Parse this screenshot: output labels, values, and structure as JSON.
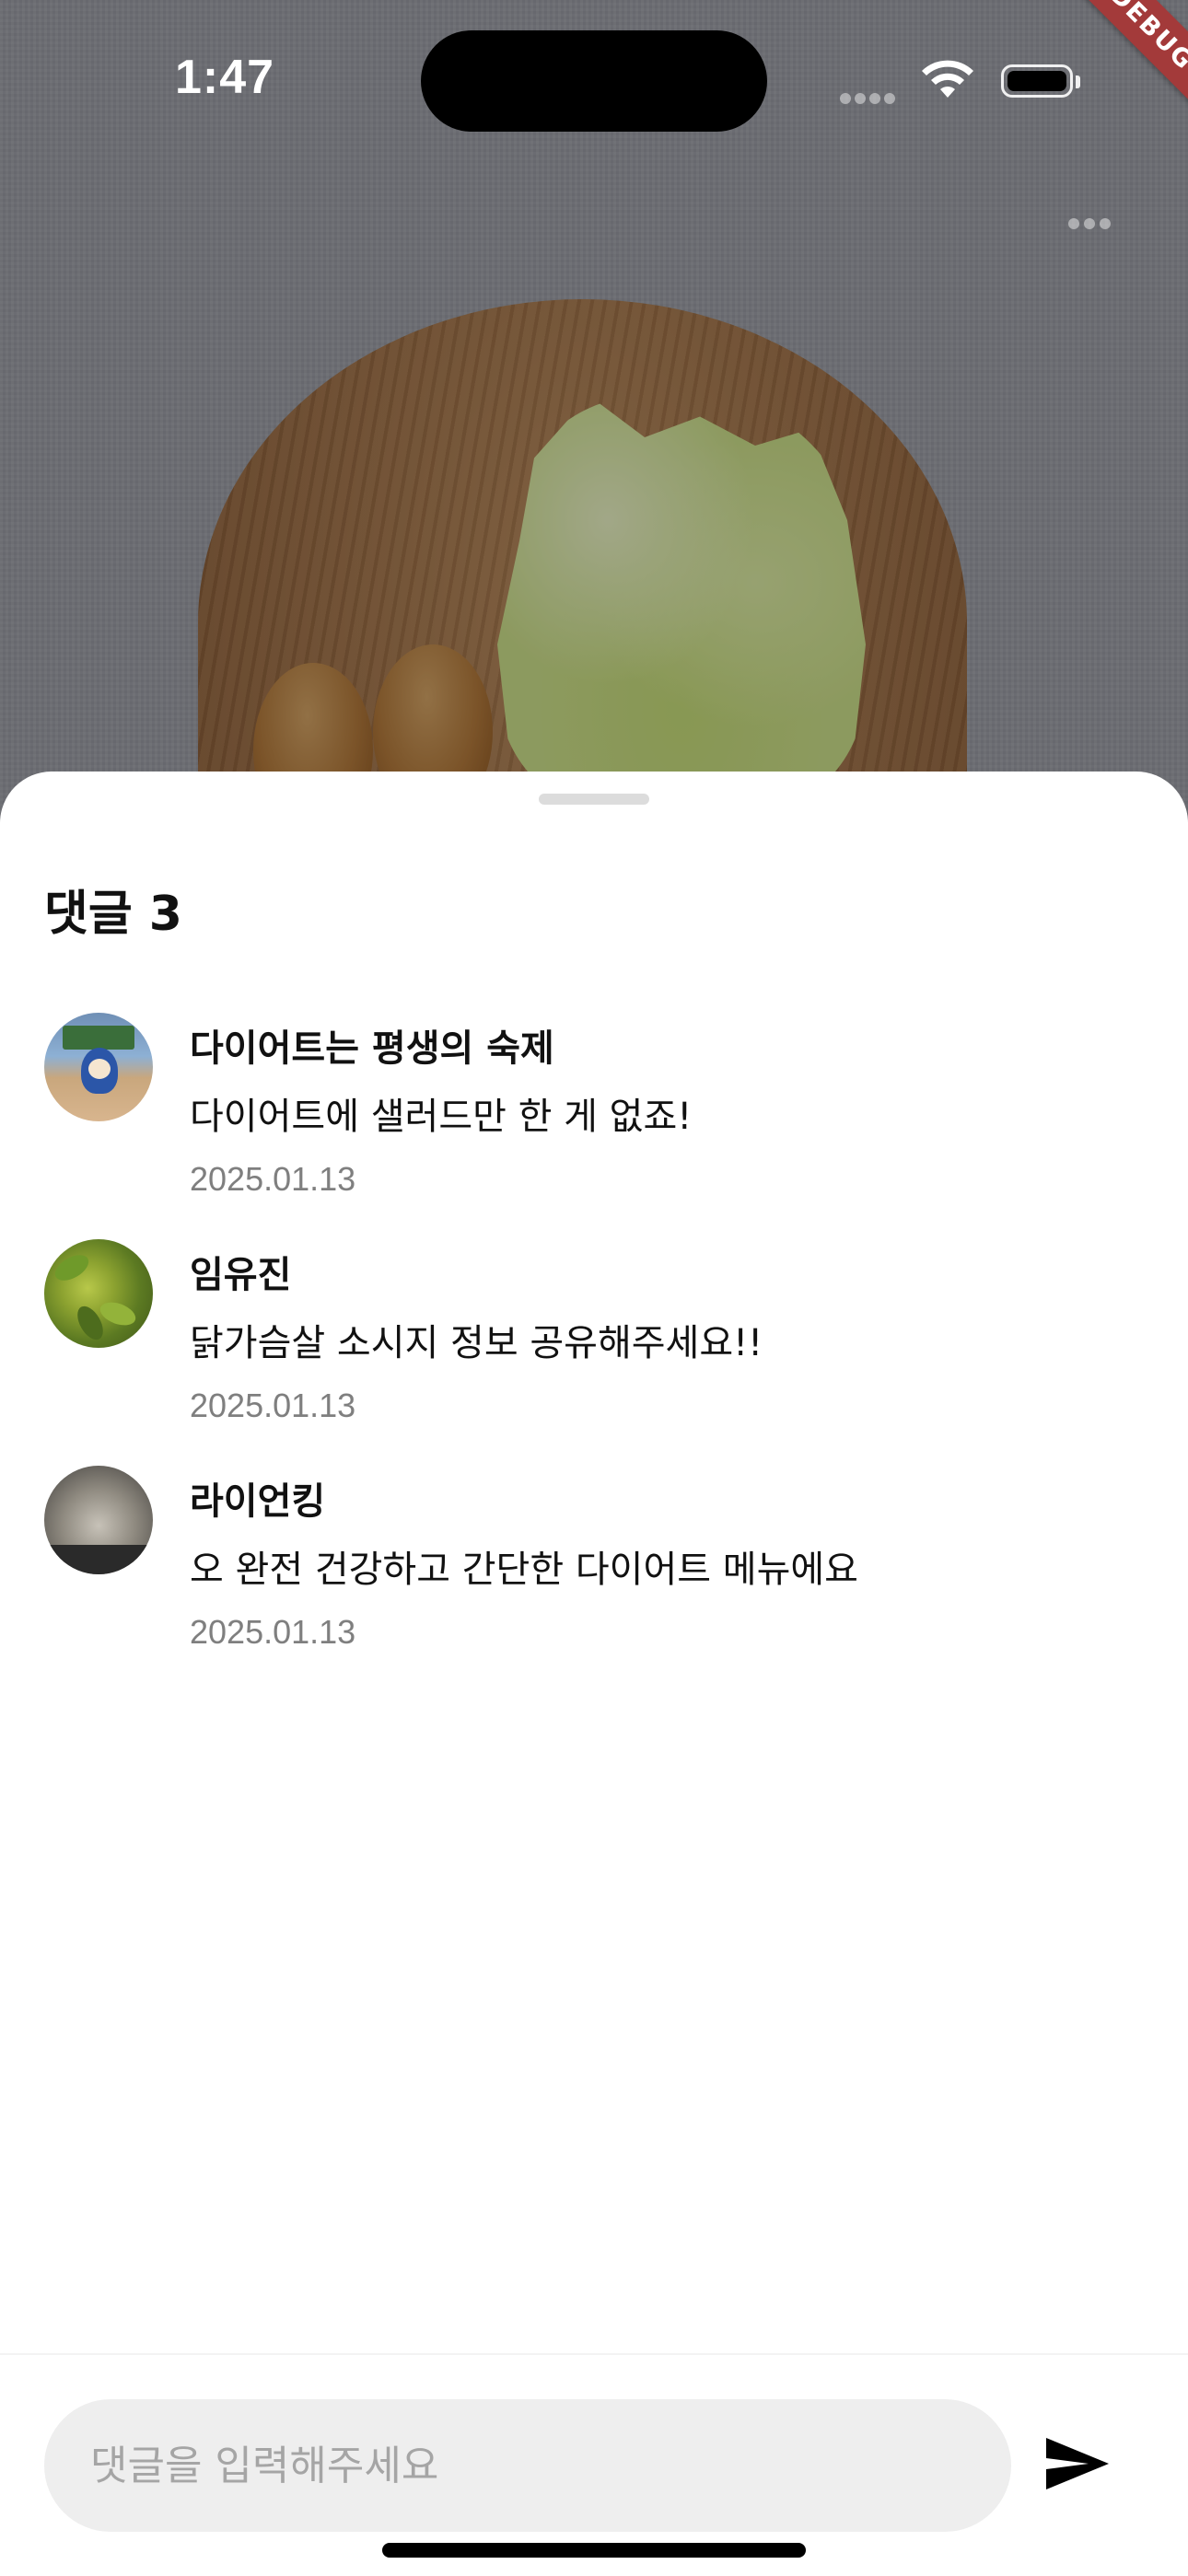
{
  "status_bar": {
    "time": "1:47",
    "debug_label": "DEBUG"
  },
  "sheet": {
    "title": "댓글 3"
  },
  "comments": [
    {
      "author": "다이어트는 평생의 숙제",
      "text": "다이어트에 샐러드만 한 게 없죠!",
      "date": "2025.01.13"
    },
    {
      "author": "임유진",
      "text": "닭가슴살 소시지 정보 공유해주세요!!",
      "date": "2025.01.13"
    },
    {
      "author": "라이언킹",
      "text": "오 완전 건강하고 간단한 다이어트 메뉴에요",
      "date": "2025.01.13"
    }
  ],
  "input": {
    "placeholder": "댓글을 입력해주세요",
    "value": ""
  },
  "icons": {
    "more": "more-horizontal-icon",
    "send": "send-icon",
    "wifi": "wifi-icon",
    "battery": "battery-icon",
    "signal": "signal-icon"
  },
  "colors": {
    "sheet_background": "#ffffff",
    "input_background": "#eeeeee",
    "date_text": "#7f7f7f",
    "debug_ribbon": "#a33a3a"
  }
}
